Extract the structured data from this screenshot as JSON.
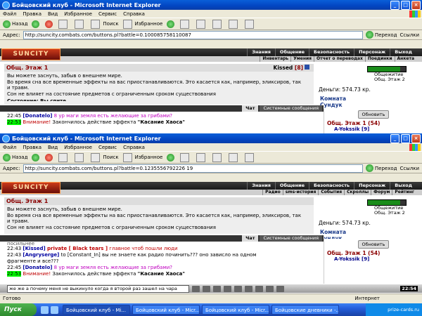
{
  "browser": {
    "title": "Бойцовский клуб - Microsoft Internet Explorer",
    "menu": [
      "Файл",
      "Правка",
      "Вид",
      "Избранное",
      "Сервис",
      "Справка"
    ],
    "toolbar": {
      "back": "Назад",
      "search": "Поиск",
      "favorites": "Избранное"
    },
    "address_label": "Адрес:",
    "go_label": "Переход",
    "links_label": "Ссылки"
  },
  "window1": {
    "url": "http://suncity.combats.com/buttons.pl?battle=0.100085758110087"
  },
  "window2": {
    "url": "http://suncity.combats.com/buttons.pl?battle=0.1235556792226 19"
  },
  "game": {
    "logo": "SUNCITY",
    "nav": [
      "Знания",
      "Общение",
      "Безопасность",
      "Персонаж",
      "Выход"
    ],
    "subnav1": [
      "Инвентарь",
      "Умения",
      "Отчет о переводах",
      "Поединки",
      "Анкета"
    ],
    "subnav2": [
      "Радио",
      "sms-история",
      "События",
      "Скроллы",
      "Форум",
      "Рейтинг"
    ],
    "location_title": "Общ. Этаж 1",
    "user": "Kissed",
    "level": "[8]",
    "level_icon": "info-icon",
    "messages": [
      "Вы можете заснуть, забыв о внешнем мире.",
      "Во время сна все временные эффекты на вас приостанавливаются. Это касается как, например, эликсиров, так",
      "и травм.",
      "Сон не влияет на состояние предметов с ограниченным сроком существования"
    ],
    "cut_line1": "Состояние: Вы спите",
    "cut_line2": "посильнее",
    "hp_fraction": 0.85,
    "side_labels": [
      "Общежитие",
      "Общ. Этаж 2"
    ],
    "money": "Деньги: 574.73 кр.",
    "links": [
      "Комната",
      "Сундук"
    ],
    "tabs": [
      "Чат",
      "Системные сообщения"
    ],
    "refresh": "Обновить",
    "room": "Общ. Этаж 1 (54)",
    "player": "A-Yokssik",
    "player_level": "[9]",
    "chat1": [
      {
        "time": "22:45",
        "nick": "[Donatelo]",
        "text": " 8 ур маги земля есть желающие за грибами?",
        "cls": "magenta"
      },
      {
        "time": "22:53",
        "pre": "Внимание!",
        "text": " Закончилось действие эффекта ",
        "effect": "\"Касание Хаоса\""
      }
    ],
    "chat2": [
      {
        "time": "22:43",
        "nick": "[Kissed]",
        "priv": "private [ Black tears ]",
        "text": " главное чтоб пошли люди"
      },
      {
        "time": "22:43",
        "nick": "[Angryserge]",
        "text": " to [Constant_In] вы не знаете как радио починить??? оно зависло на одном"
      },
      {
        "cont": "фрагменте и все???"
      },
      {
        "time": "22:45",
        "nick": "[Donatelo]",
        "text": " 8 ур маги земля есть желающие за грибами?",
        "cls": "magenta"
      },
      {
        "time": "22:53",
        "pre": "Внимание!",
        "text": " Закончилось действие эффекта ",
        "effect": "\"Касание Хаоса\""
      }
    ],
    "chat_input": "же же а почему меня не выкинуло когда я второй раз зашел на чара",
    "clock": "22:54"
  },
  "status": {
    "left": "Готово",
    "right": "Интернет"
  },
  "taskbar": {
    "start": "Пуск",
    "tasks": [
      "Бойцовский клуб - Mi...",
      "Бойцовский клуб - Micr...",
      "Бойцовский клуб - Micr...",
      "Бойцовские дневники -..."
    ],
    "tray": "prize-cards.ru"
  }
}
